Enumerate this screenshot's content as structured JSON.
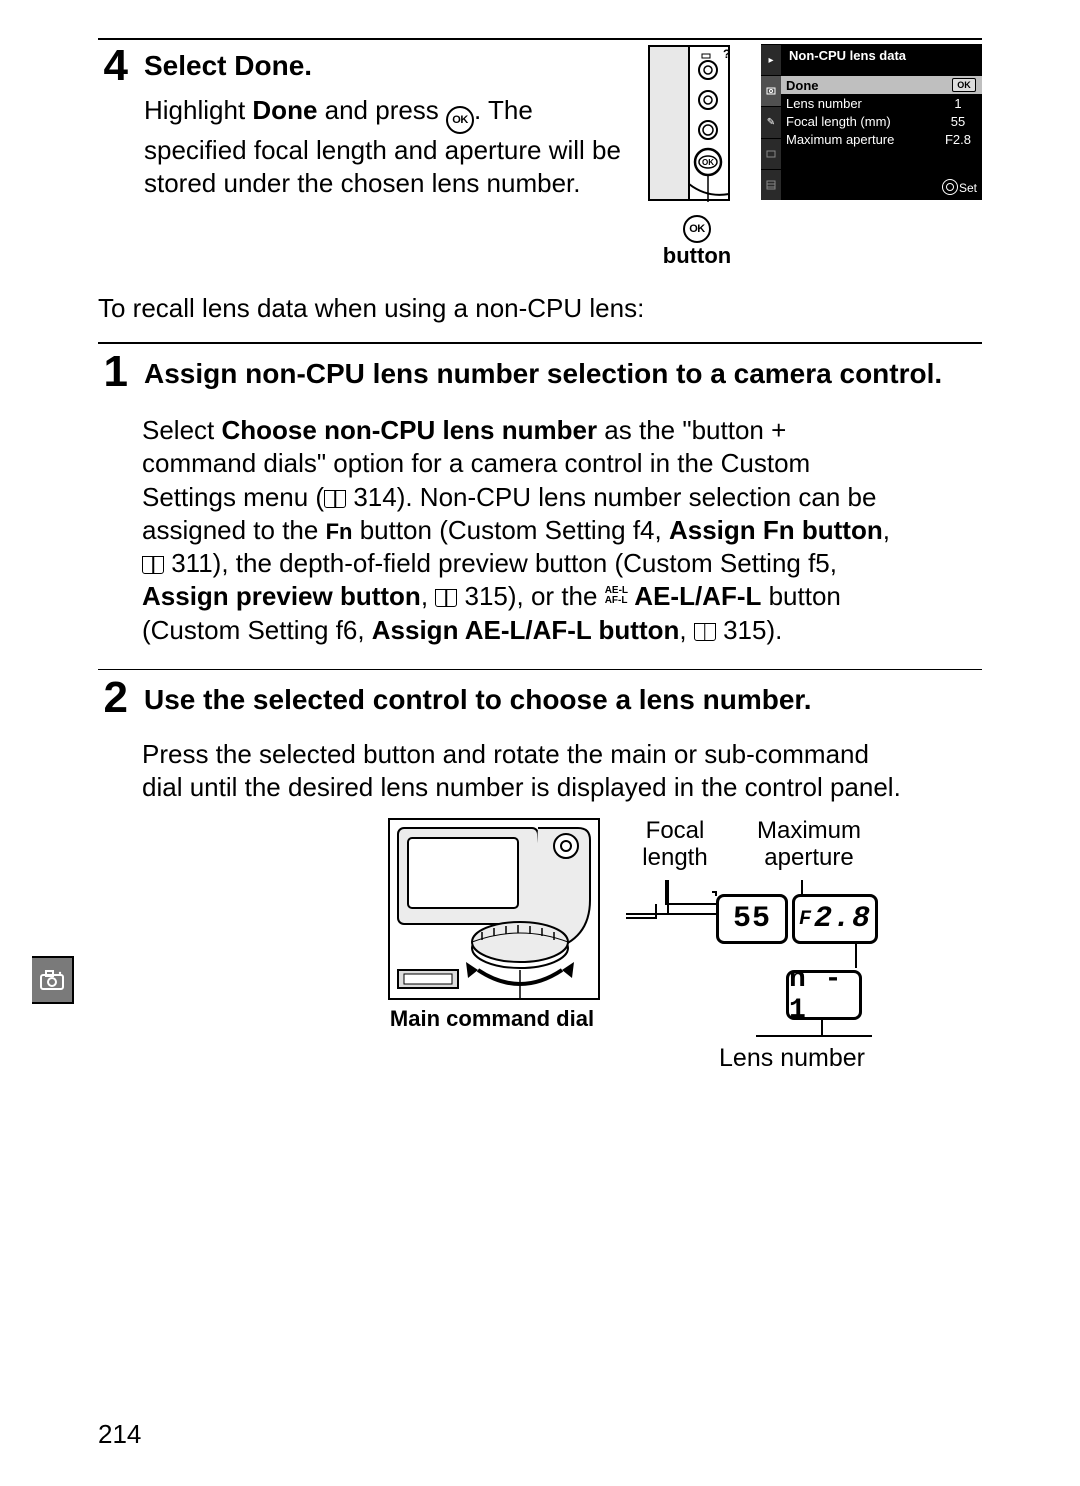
{
  "page_number": "214",
  "step4": {
    "number": "4",
    "title_pre": "Select ",
    "title_strong": "Done",
    "title_post": ".",
    "body_pre": "Highlight ",
    "body_strong": "Done",
    "body_mid1": " and press ",
    "ok_glyph": "OK",
    "body_mid2": ".  The specified focal length and aperture will be stored under the chosen lens number.",
    "ok_button_caption_pre": " button",
    "lcd": {
      "title": "Non-CPU lens data",
      "rows": [
        {
          "label": "Done",
          "val": "",
          "badge": "OK",
          "hl": true
        },
        {
          "label": "Lens number",
          "val": "1"
        },
        {
          "label": "Focal length (mm)",
          "val": "55"
        },
        {
          "label": "Maximum aperture",
          "val": "F2.8"
        }
      ],
      "set": "Set"
    }
  },
  "recall": "To recall lens data when using a non-CPU lens:",
  "step1": {
    "number": "1",
    "title": "Assign non-CPU lens number selection to a camera control.",
    "body_p1_a": "Select ",
    "body_p1_b": "Choose non-CPU lens number",
    "body_p1_c": " as the \"button + command dials\" option for a camera control in the Custom Settings menu (",
    "body_p1_ref1": " 314).  Non-CPU lens number selection can be assigned to the ",
    "fn_label": "Fn",
    "body_p1_d": " button (Custom Setting f4, ",
    "body_p1_e": "Assign Fn button",
    "body_p1_f": ", ",
    "body_p1_ref2": " 311), the depth-of-field preview button (Custom Setting f5, ",
    "body_p1_g": "Assign preview button",
    "body_p1_h": ", ",
    "body_p1_ref3": " 315), or the ",
    "ael_tiny_top": "AE-L",
    "ael_tiny_bot": "AF-L",
    "body_p1_i": " AE-L/AF-L",
    "body_p1_j": " button (Custom Setting f6, ",
    "body_p1_k": "Assign AE-L/AF-L button",
    "body_p1_l": ", ",
    "body_p1_ref4": " 315)."
  },
  "step2": {
    "number": "2",
    "title": "Use the selected control to choose a lens number.",
    "body": "Press the selected button and rotate the main or sub-command dial until the desired lens number is displayed in the control panel.",
    "dial_caption": "Main command dial",
    "panel": {
      "focal_label": "Focal length",
      "aper_label": "Maximum aperture",
      "focal_val": "55",
      "aper_val": "F2.8",
      "lensnum_val": "n - 1",
      "lensnum_label": "Lens number"
    }
  }
}
